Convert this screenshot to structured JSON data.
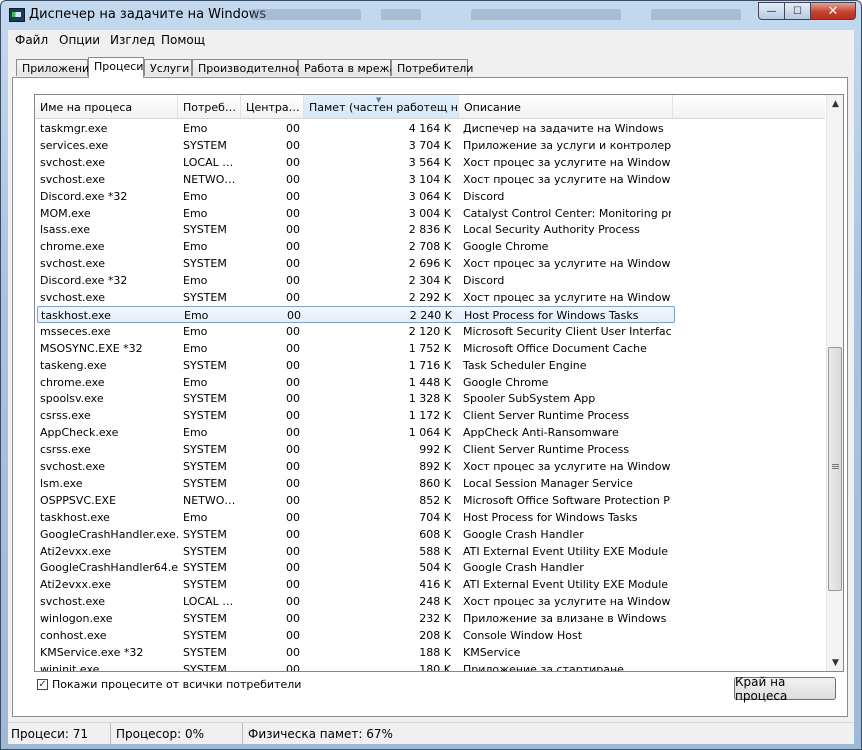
{
  "window": {
    "title": "Диспечер на задачите на Windows",
    "buttons": {
      "minimize": "—",
      "maximize": "☐",
      "close": "✕"
    }
  },
  "menu": [
    "Файл",
    "Опции",
    "Изглед",
    "Помощ"
  ],
  "tabs": [
    "Приложения",
    "Процеси",
    "Услуги",
    "Производителност",
    "Работа в мрежа",
    "Потребители"
  ],
  "active_tab": "Процеси",
  "columns": [
    "Име на процеса",
    "Потреб…",
    "Центра…",
    "Памет (частен работещ н…",
    "Описание"
  ],
  "processes": [
    {
      "name": "taskmgr.exe",
      "user": "Emo",
      "cpu": "00",
      "mem": "4 164 K",
      "desc": "Диспечер на задачите на Windows"
    },
    {
      "name": "services.exe",
      "user": "SYSTEM",
      "cpu": "00",
      "mem": "3 704 K",
      "desc": "Приложение за услуги и контролери"
    },
    {
      "name": "svchost.exe",
      "user": "LOCAL …",
      "cpu": "00",
      "mem": "3 564 K",
      "desc": "Хост процес за услугите на Windows"
    },
    {
      "name": "svchost.exe",
      "user": "NETWO…",
      "cpu": "00",
      "mem": "3 104 K",
      "desc": "Хост процес за услугите на Windows"
    },
    {
      "name": "Discord.exe *32",
      "user": "Emo",
      "cpu": "00",
      "mem": "3 064 K",
      "desc": "Discord"
    },
    {
      "name": "MOM.exe",
      "user": "Emo",
      "cpu": "00",
      "mem": "3 004 K",
      "desc": "Catalyst Control Center: Monitoring pr…"
    },
    {
      "name": "lsass.exe",
      "user": "SYSTEM",
      "cpu": "00",
      "mem": "2 836 K",
      "desc": "Local Security Authority Process"
    },
    {
      "name": "chrome.exe",
      "user": "Emo",
      "cpu": "00",
      "mem": "2 708 K",
      "desc": "Google Chrome"
    },
    {
      "name": "svchost.exe",
      "user": "SYSTEM",
      "cpu": "00",
      "mem": "2 696 K",
      "desc": "Хост процес за услугите на Windows"
    },
    {
      "name": "Discord.exe *32",
      "user": "Emo",
      "cpu": "00",
      "mem": "2 304 K",
      "desc": "Discord"
    },
    {
      "name": "svchost.exe",
      "user": "SYSTEM",
      "cpu": "00",
      "mem": "2 292 K",
      "desc": "Хост процес за услугите на Windows"
    },
    {
      "name": "taskhost.exe",
      "user": "Emo",
      "cpu": "00",
      "mem": "2 240 K",
      "desc": "Host Process for Windows Tasks",
      "selected": true
    },
    {
      "name": "msseces.exe",
      "user": "Emo",
      "cpu": "00",
      "mem": "2 120 K",
      "desc": "Microsoft Security Client User Interface"
    },
    {
      "name": "MSOSYNC.EXE *32",
      "user": "Emo",
      "cpu": "00",
      "mem": "1 752 K",
      "desc": "Microsoft Office Document Cache"
    },
    {
      "name": "taskeng.exe",
      "user": "SYSTEM",
      "cpu": "00",
      "mem": "1 716 K",
      "desc": "Task Scheduler Engine"
    },
    {
      "name": "chrome.exe",
      "user": "Emo",
      "cpu": "00",
      "mem": "1 448 K",
      "desc": "Google Chrome"
    },
    {
      "name": "spoolsv.exe",
      "user": "SYSTEM",
      "cpu": "00",
      "mem": "1 328 K",
      "desc": "Spooler SubSystem App"
    },
    {
      "name": "csrss.exe",
      "user": "SYSTEM",
      "cpu": "00",
      "mem": "1 172 K",
      "desc": "Client Server Runtime Process"
    },
    {
      "name": "AppCheck.exe",
      "user": "Emo",
      "cpu": "00",
      "mem": "1 064 K",
      "desc": "AppCheck Anti-Ransomware"
    },
    {
      "name": "csrss.exe",
      "user": "SYSTEM",
      "cpu": "00",
      "mem": "992 K",
      "desc": "Client Server Runtime Process"
    },
    {
      "name": "svchost.exe",
      "user": "SYSTEM",
      "cpu": "00",
      "mem": "892 K",
      "desc": "Хост процес за услугите на Windows"
    },
    {
      "name": "lsm.exe",
      "user": "SYSTEM",
      "cpu": "00",
      "mem": "860 K",
      "desc": "Local Session Manager Service"
    },
    {
      "name": "OSPPSVC.EXE",
      "user": "NETWO…",
      "cpu": "00",
      "mem": "852 K",
      "desc": "Microsoft Office Software Protection Pl…"
    },
    {
      "name": "taskhost.exe",
      "user": "Emo",
      "cpu": "00",
      "mem": "704 K",
      "desc": "Host Process for Windows Tasks"
    },
    {
      "name": "GoogleCrashHandler.exe…",
      "user": "SYSTEM",
      "cpu": "00",
      "mem": "608 K",
      "desc": "Google Crash Handler"
    },
    {
      "name": "Ati2evxx.exe",
      "user": "SYSTEM",
      "cpu": "00",
      "mem": "588 K",
      "desc": "ATI External Event Utility EXE Module"
    },
    {
      "name": "GoogleCrashHandler64.exe",
      "user": "SYSTEM",
      "cpu": "00",
      "mem": "504 K",
      "desc": "Google Crash Handler"
    },
    {
      "name": "Ati2evxx.exe",
      "user": "SYSTEM",
      "cpu": "00",
      "mem": "416 K",
      "desc": "ATI External Event Utility EXE Module"
    },
    {
      "name": "svchost.exe",
      "user": "LOCAL …",
      "cpu": "00",
      "mem": "248 K",
      "desc": "Хост процес за услугите на Windows"
    },
    {
      "name": "winlogon.exe",
      "user": "SYSTEM",
      "cpu": "00",
      "mem": "232 K",
      "desc": "Приложение за влизане в Windows"
    },
    {
      "name": "conhost.exe",
      "user": "SYSTEM",
      "cpu": "00",
      "mem": "208 K",
      "desc": "Console Window Host"
    },
    {
      "name": "KMService.exe *32",
      "user": "SYSTEM",
      "cpu": "00",
      "mem": "188 K",
      "desc": "KMService"
    },
    {
      "name": "wininit.exe",
      "user": "SYSTEM",
      "cpu": "00",
      "mem": "180 K",
      "desc": "Приложение за стартиране"
    }
  ],
  "show_all_label": "Покажи процесите от всички потребители",
  "show_all_checked": true,
  "end_process_label": "Край на процеса",
  "status": {
    "processes": "Процеси: 71",
    "cpu": "Процесор: 0%",
    "memory": "Физическа памет: 67%"
  }
}
